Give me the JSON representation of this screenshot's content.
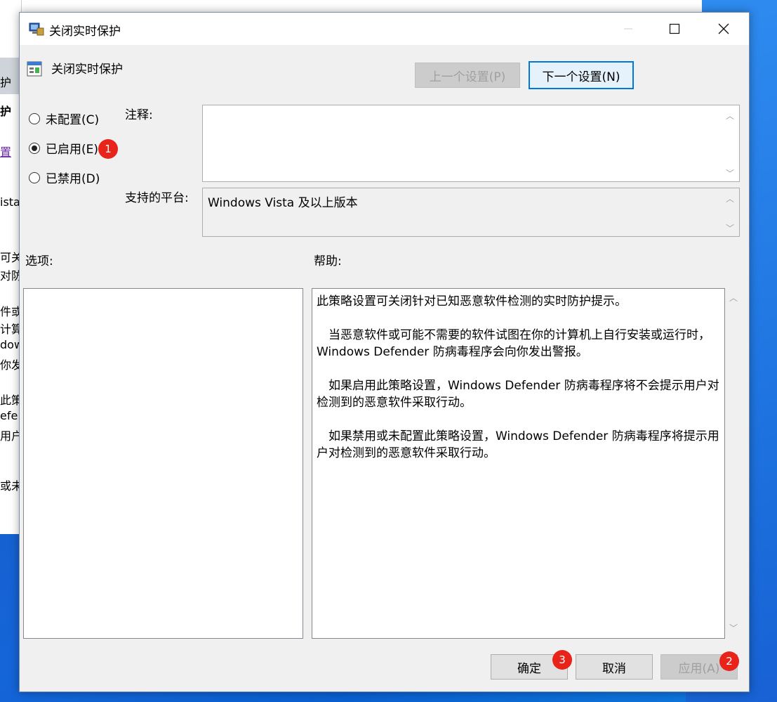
{
  "background_window": {
    "fragments": [
      "护",
      "护",
      "置",
      "ista",
      "可关",
      "对防",
      "件或",
      "计算",
      "dows",
      "你发",
      "此策",
      "efe",
      "用户",
      "或未"
    ]
  },
  "dialog": {
    "title": "关闭实时保护",
    "header_title": "关闭实时保护",
    "prev_button": "上一个设置(P)",
    "next_button": "下一个设置(N)",
    "radios": [
      {
        "label": "未配置(C)",
        "checked": false
      },
      {
        "label": "已启用(E)",
        "checked": true
      },
      {
        "label": "已禁用(D)",
        "checked": false
      }
    ],
    "comment_label": "注释:",
    "comment_value": "",
    "platform_label": "支持的平台:",
    "platform_value": "Windows Vista 及以上版本",
    "options_label": "选项:",
    "help_label": "帮助:",
    "help_paragraphs": [
      "此策略设置可关闭针对已知恶意软件检测的实时防护提示。",
      "　当恶意软件或可能不需要的软件试图在你的计算机上自行安装或运行时，Windows Defender 防病毒程序会向你发出警报。",
      "　如果启用此策略设置，Windows Defender 防病毒程序将不会提示用户对检测到的恶意软件采取行动。",
      "　如果禁用或未配置此策略设置，Windows Defender 防病毒程序将提示用户对检测到的恶意软件采取行动。"
    ],
    "ok_button": "确定",
    "cancel_button": "取消",
    "apply_button": "应用(A)"
  },
  "annotations": {
    "badge1": "1",
    "badge2": "2",
    "badge3": "3",
    "badge_color": "#e8231a"
  },
  "icons": {
    "title_icon": "policy-shield-icon",
    "header_icon": "policy-setting-icon",
    "minimize": "minimize-icon",
    "maximize": "maximize-icon",
    "close": "close-icon"
  }
}
